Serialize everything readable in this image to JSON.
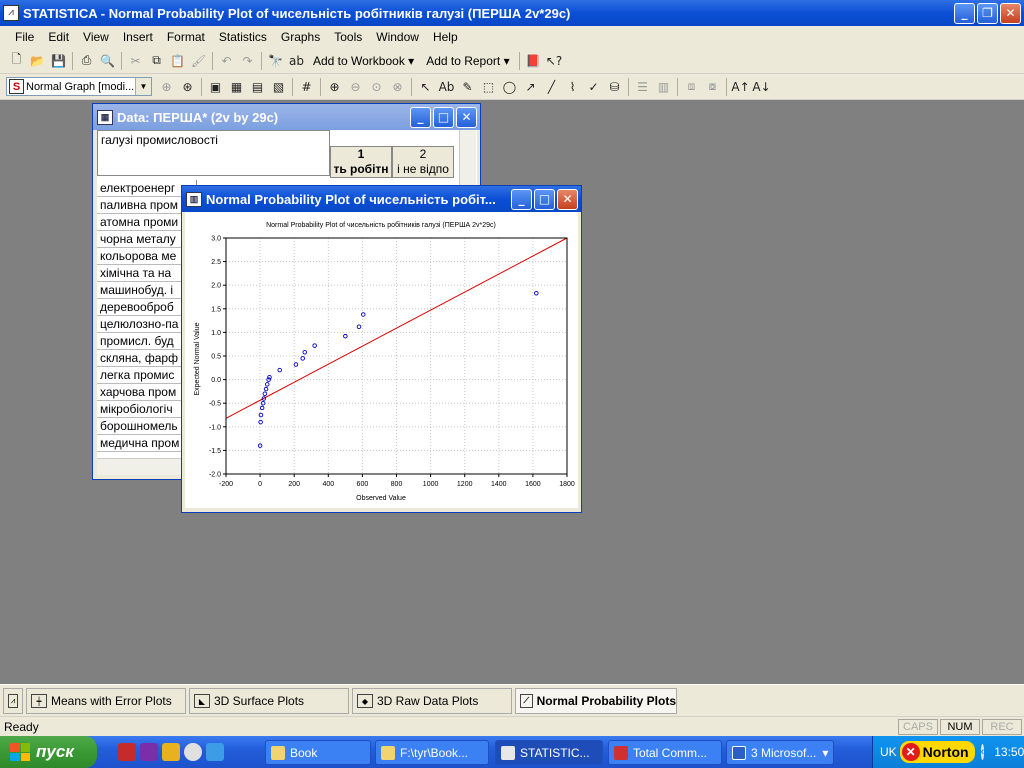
{
  "app": {
    "title": "STATISTICA - Normal Probability Plot of чисельність робітників галузі (ПЕРША 2v*29c)"
  },
  "menu": [
    "File",
    "Edit",
    "View",
    "Insert",
    "Format",
    "Statistics",
    "Graphs",
    "Tools",
    "Window",
    "Help"
  ],
  "toolbar": {
    "add_to_workbook": "Add to Workbook",
    "add_to_report": "Add to Report",
    "graph_combo": "Normal Graph [modi..."
  },
  "data_window": {
    "title": "Data: ПЕРША* (2v by 29c)",
    "header_label": "галузі промисловості",
    "columns": [
      {
        "num": "1",
        "name": "ть робітн"
      },
      {
        "num": "2",
        "name": "і не відпо"
      }
    ],
    "rows": [
      "електроенерг",
      "паливна пром",
      "атомна проми",
      "чорна металу",
      "кольорова ме",
      "хімічна та на",
      "машинобуд. і",
      "деревооброб",
      "целюлозно-па",
      "промисл. буд",
      "скляна, фарф",
      "легка промис",
      "харчова пром",
      "мікробіологіч",
      "борошномель",
      "медична пром"
    ]
  },
  "plot_window": {
    "title": "Normal Probability Plot of чисельність робіт..."
  },
  "chart_data": {
    "type": "scatter",
    "title": "Normal Probability Plot of чисельність робітників галузі (ПЕРША 2v*29c)",
    "xlabel": "Observed Value",
    "ylabel": "Expected Normal Value",
    "xlim": [
      -200,
      1800
    ],
    "ylim": [
      -2.0,
      3.0
    ],
    "xticks": [
      "-200",
      "0",
      "200",
      "400",
      "600",
      "800",
      "1000",
      "1200",
      "1400",
      "1600",
      "1800"
    ],
    "yticks": [
      "-2.0",
      "-1.5",
      "-1.0",
      "-0.5",
      "0.0",
      "0.5",
      "1.0",
      "1.5",
      "2.0",
      "2.5",
      "3.0"
    ],
    "grid": true,
    "points": [
      {
        "x": 0,
        "y": -1.4
      },
      {
        "x": 3,
        "y": -0.9
      },
      {
        "x": 5,
        "y": -0.75
      },
      {
        "x": 12,
        "y": -0.6
      },
      {
        "x": 18,
        "y": -0.5
      },
      {
        "x": 22,
        "y": -0.4
      },
      {
        "x": 28,
        "y": -0.3
      },
      {
        "x": 35,
        "y": -0.2
      },
      {
        "x": 42,
        "y": -0.1
      },
      {
        "x": 50,
        "y": 0.0
      },
      {
        "x": 55,
        "y": 0.05
      },
      {
        "x": 115,
        "y": 0.2
      },
      {
        "x": 210,
        "y": 0.32
      },
      {
        "x": 250,
        "y": 0.45
      },
      {
        "x": 262,
        "y": 0.58
      },
      {
        "x": 320,
        "y": 0.72
      },
      {
        "x": 500,
        "y": 0.92
      },
      {
        "x": 580,
        "y": 1.12
      },
      {
        "x": 605,
        "y": 1.38
      },
      {
        "x": 1620,
        "y": 1.83
      }
    ],
    "reference_line": {
      "x": [
        -200,
        1800
      ],
      "y": [
        -0.82,
        3.0
      ]
    },
    "colors": {
      "points": "#0000cc",
      "line": "#e00000"
    }
  },
  "task_switcher": [
    {
      "label": "Means with Error Plots",
      "active": false
    },
    {
      "label": "3D Surface Plots",
      "active": false
    },
    {
      "label": "3D Raw Data Plots",
      "active": false
    },
    {
      "label": "Normal Probability Plots",
      "active": true
    }
  ],
  "status": {
    "text": "Ready",
    "caps": "CAPS",
    "num": "NUM",
    "rec": "REC"
  },
  "taskbar": {
    "start": "пуск",
    "items": [
      "Book",
      "F:\\tyr\\Book...",
      "STATISTIC...",
      "Total Comm...",
      "3 Microsof..."
    ],
    "lang": "UK",
    "norton": "Norton",
    "clock": "13:50"
  }
}
